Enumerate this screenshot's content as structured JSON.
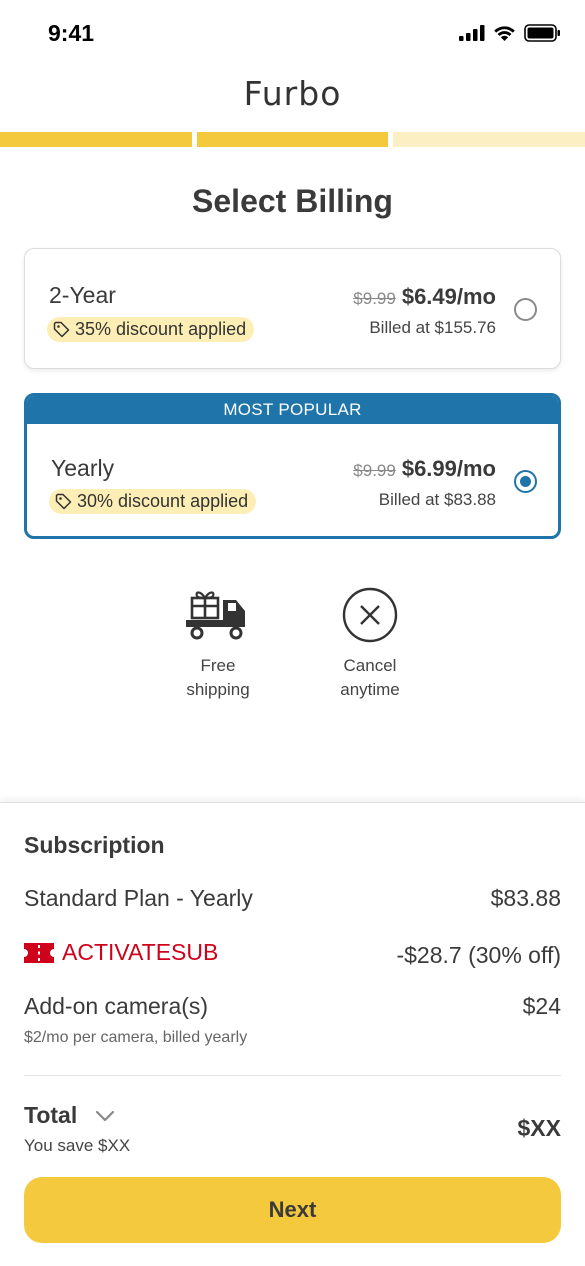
{
  "status_bar": {
    "time": "9:41",
    "icons": [
      "signal-icon",
      "wifi-icon",
      "battery-icon"
    ]
  },
  "header": {
    "logo": "Furbo"
  },
  "progress": {
    "steps_total": 3,
    "steps_completed": 2,
    "colors": {
      "done": "#f5c93e",
      "todo": "#fcefc4"
    }
  },
  "page": {
    "title": "Select Billing"
  },
  "plans": [
    {
      "name": "2-Year",
      "discount": "35% discount applied",
      "old_price": "$9.99",
      "price": "$6.49/mo",
      "billed": "Billed at $155.76",
      "selected": false
    },
    {
      "banner": "MOST POPULAR",
      "name": "Yearly",
      "discount": "30% discount applied",
      "old_price": "$9.99",
      "price": "$6.99/mo",
      "billed": "Billed at $83.88",
      "selected": true
    }
  ],
  "perks": [
    {
      "icon": "delivery-truck-gift-icon",
      "label_1": "Free",
      "label_2": "shipping"
    },
    {
      "icon": "cancel-circle-icon",
      "label_1": "Cancel",
      "label_2": "anytime"
    }
  ],
  "summary": {
    "title": "Subscription",
    "plan_label": "Standard Plan - Yearly",
    "plan_price": "$83.88",
    "promo_code": "ACTIVATESUB",
    "promo_amount": "-$28.7 (30% off)",
    "addon_label": "Add-on camera(s)",
    "addon_price": "$24",
    "addon_note": "$2/mo per camera, billed yearly",
    "total_label": "Total",
    "total_value": "$XX",
    "save_note": "You save $XX",
    "next_label": "Next"
  },
  "colors": {
    "accent_yellow": "#f5c93e",
    "popular_blue": "#1f74a9",
    "promo_red": "#d0021b",
    "discount_bg": "#fdeeb6"
  }
}
